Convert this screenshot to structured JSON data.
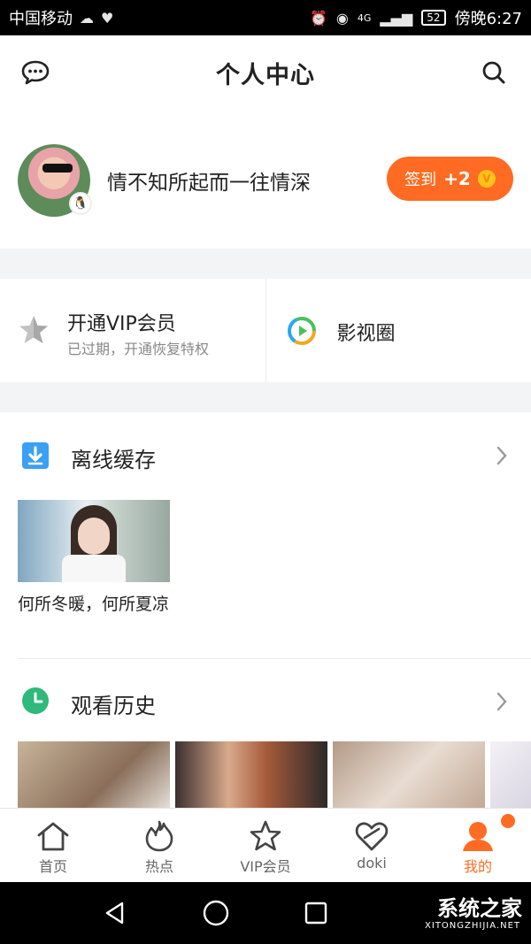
{
  "status_bar": {
    "carrier": "中国移动",
    "time": "傍晚6:27",
    "battery": "52",
    "network": "4G"
  },
  "header": {
    "title": "个人中心"
  },
  "profile": {
    "username": "情不知所起而一往情深",
    "checkin_label": "签到",
    "checkin_points": "+2",
    "coin_symbol": "V"
  },
  "vip": {
    "title": "开通VIP会员",
    "subtitle": "已过期，开通恢复特权",
    "circle_title": "影视圈"
  },
  "offline": {
    "title": "离线缓存",
    "items": [
      {
        "title": "何所冬暖，何所夏凉"
      }
    ]
  },
  "history": {
    "title": "观看历史",
    "items": [
      {
        "color": "#9c7f6a"
      },
      {
        "color": "#d9a98b"
      },
      {
        "color": "#d7c7ba"
      },
      {
        "color": "#eeeaf0"
      }
    ]
  },
  "tabs": [
    {
      "label": "首页",
      "icon": "home-icon"
    },
    {
      "label": "热点",
      "icon": "flame-icon"
    },
    {
      "label": "VIP会员",
      "icon": "crown-star-icon"
    },
    {
      "label": "doki",
      "icon": "heart-outline-icon"
    },
    {
      "label": "我的",
      "icon": "person-icon",
      "active": true
    }
  ],
  "watermark": {
    "text": "系统之家",
    "sub": "XITONGZHIJIA.NET"
  },
  "colors": {
    "accent": "#ff6b22",
    "coin": "#ffc21a",
    "download": "#3aa0f3",
    "history_icon": "#2fb97a"
  }
}
